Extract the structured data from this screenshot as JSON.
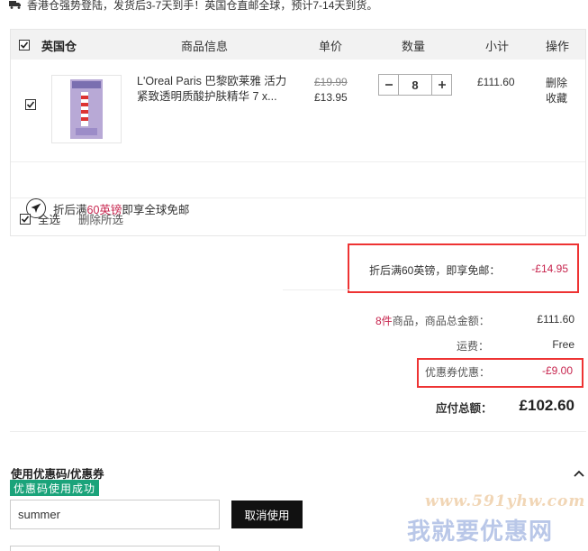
{
  "notice": {
    "text": "香港仓强势登陆，发货后3-7天到手！英国仓直邮全球，预计7-14天到货。"
  },
  "cart": {
    "warehouse": "英国仓",
    "columns": {
      "product": "商品信息",
      "unit_price": "单价",
      "quantity": "数量",
      "subtotal": "小计",
      "actions": "操作"
    },
    "item": {
      "name": "L'Oreal Paris 巴黎欧莱雅 活力紧致透明质酸护肤精华 7 x...",
      "original_price": "£19.99",
      "price": "£13.95",
      "quantity": "8",
      "subtotal": "£111.60",
      "delete": "删除",
      "favorite": "收藏"
    },
    "promo": {
      "prefix": "折后满",
      "amount": "60英镑",
      "suffix": "即享全球免邮"
    },
    "select_all": "全选",
    "delete_selected": "删除所选"
  },
  "summary": {
    "free_shipping_label": "折后满60英镑，即享免邮：",
    "free_shipping_value": "-£14.95",
    "count": "8件",
    "goods_total_label": "商品，商品总金额：",
    "goods_total": "£111.60",
    "shipping_label": "运费：",
    "shipping": "Free",
    "coupon_label": "优惠券优惠：",
    "coupon": "-£9.00",
    "total_label": "应付总额：",
    "total": "£102.60"
  },
  "coupon": {
    "title": "使用优惠码/优惠券",
    "success": "优惠码使用成功",
    "code": "summer",
    "cancel": "取消使用"
  },
  "watermark": {
    "url": "www.591yhw.com",
    "text": "我就要优惠网"
  },
  "colors": {
    "accent_red": "#c7254e",
    "success_green": "#1aa37a",
    "highlight_box": "#e33333"
  }
}
